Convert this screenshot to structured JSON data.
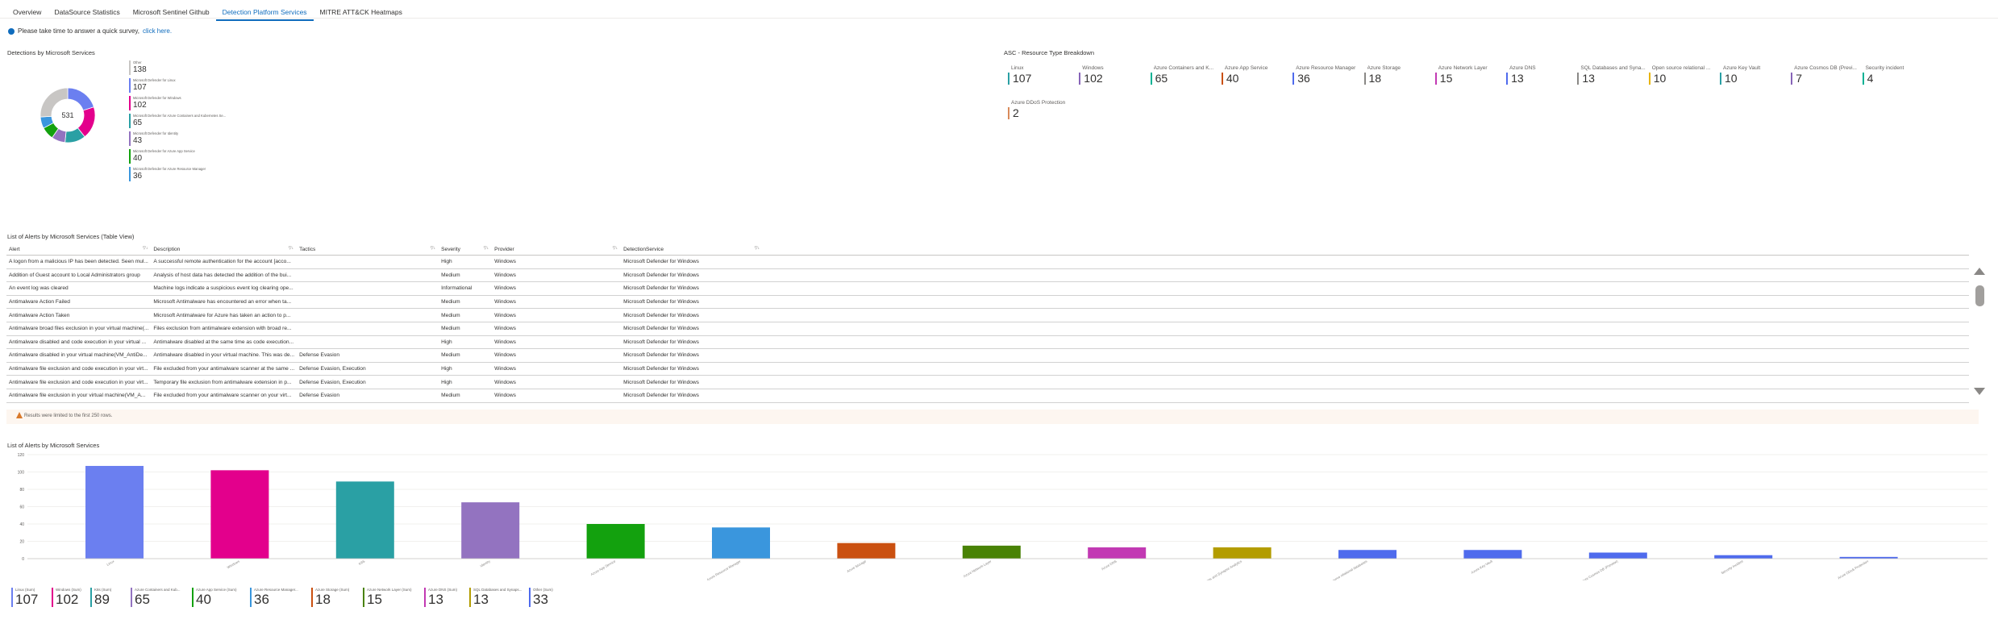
{
  "tabs": [
    "Overview",
    "DataSource Statistics",
    "Microsoft Sentinel Github",
    "Detection Platform Services",
    "MITRE ATT&CK Heatmaps"
  ],
  "active_tab": 3,
  "survey": {
    "text": "Please take time to answer a quick survey,",
    "link": "click here."
  },
  "donut": {
    "title": "Detections by Microsoft Services",
    "total": "531",
    "items": [
      {
        "label": "Other",
        "value": "138",
        "color": "#c8c6c4"
      },
      {
        "label": "Microsoft Defender for Linux",
        "value": "107",
        "color": "#6b7ff0"
      },
      {
        "label": "Microsoft Defender for Windows",
        "value": "102",
        "color": "#e3008c"
      },
      {
        "label": "Microsoft Defender for Azure Containers and Kubernetes Se...",
        "value": "65",
        "color": "#2aa0a4"
      },
      {
        "label": "Microsoft Defender for Identity",
        "value": "43",
        "color": "#9373c0"
      },
      {
        "label": "Microsoft Defender for Azure App Service",
        "value": "40",
        "color": "#13a10e"
      },
      {
        "label": "Microsoft Defender for Azure Resource Manager",
        "value": "36",
        "color": "#3a96dd"
      }
    ]
  },
  "asc": {
    "title": "ASC - Resource Type Breakdown",
    "tiles": [
      {
        "label": "Linux",
        "value": "107",
        "color": "#2aa0a4"
      },
      {
        "label": "Windows",
        "value": "102",
        "color": "#8764b8"
      },
      {
        "label": "Azure Containers and K...",
        "value": "65",
        "color": "#00b294"
      },
      {
        "label": "Azure App Service",
        "value": "40",
        "color": "#ca5010"
      },
      {
        "label": "Azure Resource Manager",
        "value": "36",
        "color": "#4f6bed"
      },
      {
        "label": "Azure Storage",
        "value": "18",
        "color": "#8a8886"
      },
      {
        "label": "Azure Network Layer",
        "value": "15",
        "color": "#c239b3"
      },
      {
        "label": "Azure DNS",
        "value": "13",
        "color": "#4f6bed"
      },
      {
        "label": "SQL Databases and Syna...",
        "value": "13",
        "color": "#8a8886"
      },
      {
        "label": "Open source relational ...",
        "value": "10",
        "color": "#e8b400"
      },
      {
        "label": "Azure Key Vault",
        "value": "10",
        "color": "#2aa0a4"
      },
      {
        "label": "Azure Cosmos DB (Previ...",
        "value": "7",
        "color": "#8764b8"
      },
      {
        "label": "Security incident",
        "value": "4",
        "color": "#00b294"
      },
      {
        "label": "Azure DDoS Protection",
        "value": "2",
        "color": "#d98a5a"
      }
    ]
  },
  "table": {
    "title": "List of Alerts by Microsoft Services (Table View)",
    "columns": [
      "Alert",
      "Description",
      "Tactics",
      "Severity",
      "Provider",
      "DetectionService"
    ],
    "rows": [
      [
        "A logon from a malicious IP has been detected. Seen mul...",
        "A successful remote authentication for the account [acco...",
        "",
        "High",
        "Windows",
        "Microsoft Defender for Windows"
      ],
      [
        "Addition of Guest account to Local Administrators group",
        "Analysis of host data has detected the addition of the bui...",
        "",
        "Medium",
        "Windows",
        "Microsoft Defender for Windows"
      ],
      [
        "An event log was cleared",
        "Machine logs indicate a suspicious event log clearing ope...",
        "",
        "Informational",
        "Windows",
        "Microsoft Defender for Windows"
      ],
      [
        "Antimalware Action Failed",
        "Microsoft Antimalware has encountered an error when ta...",
        "",
        "Medium",
        "Windows",
        "Microsoft Defender for Windows"
      ],
      [
        "Antimalware Action Taken",
        "Microsoft Antimalware for Azure has taken an action to p...",
        "",
        "Medium",
        "Windows",
        "Microsoft Defender for Windows"
      ],
      [
        "Antimalware broad files exclusion in your virtual machine(...",
        "Files exclusion from antimalware extension with broad re...",
        "",
        "Medium",
        "Windows",
        "Microsoft Defender for Windows"
      ],
      [
        "Antimalware disabled and code execution in your virtual ...",
        "Antimalware disabled at the same time as code execution...",
        "",
        "High",
        "Windows",
        "Microsoft Defender for Windows"
      ],
      [
        "Antimalware disabled in your virtual machine(VM_AntiDe...",
        "Antimalware disabled in your virtual machine. This was de...",
        "Defense Evasion",
        "Medium",
        "Windows",
        "Microsoft Defender for Windows"
      ],
      [
        "Antimalware file exclusion and code execution in your virt...",
        "File excluded from your antimalware scanner at the same ...",
        "Defense Evasion, Execution",
        "High",
        "Windows",
        "Microsoft Defender for Windows"
      ],
      [
        "Antimalware file exclusion and code execution in your virt...",
        "Temporary file exclusion from antimalware extension in p...",
        "Defense Evasion, Execution",
        "High",
        "Windows",
        "Microsoft Defender for Windows"
      ],
      [
        "Antimalware file exclusion in your virtual machine(VM_A...",
        "File excluded from your antimalware scanner on your virt...",
        "Defense Evasion",
        "Medium",
        "Windows",
        "Microsoft Defender for Windows"
      ]
    ],
    "warning": "Results were limited to the first 250 rows."
  },
  "chart_data": {
    "type": "bar",
    "title": "List of Alerts by Microsoft Services",
    "categories": [
      "Linux",
      "Windows",
      "K8S",
      "Identity",
      "Azure App Service",
      "Azure Resource Manager",
      "Azure Storage",
      "Azure Network Layer",
      "Azure DNS",
      "SQL Databases and Synapse Analytics",
      "Open-source relational databases",
      "Azure Key Vault",
      "Azure Cosmos DB (Preview)",
      "Security incident",
      "Azure DDoS Protection"
    ],
    "values": [
      107,
      102,
      89,
      65,
      40,
      36,
      18,
      15,
      13,
      13,
      10,
      10,
      7,
      4,
      2
    ],
    "colors": [
      "#6b7ff0",
      "#e3008c",
      "#2aa0a4",
      "#9373c0",
      "#13a10e",
      "#3a96dd",
      "#ca5010",
      "#498205",
      "#c239b3",
      "#b39c00",
      "#4f6bed",
      "#4f6bed",
      "#4f6bed",
      "#4f6bed",
      "#4f6bed"
    ],
    "yticks": [
      "0",
      "20",
      "40",
      "60",
      "80",
      "100",
      "120"
    ],
    "ylim": [
      0,
      120
    ],
    "grid": true
  },
  "bar_legend": [
    {
      "label": "Linux (Sum)",
      "value": "107",
      "color": "#6b7ff0"
    },
    {
      "label": "Windows (Sum)",
      "value": "102",
      "color": "#e3008c"
    },
    {
      "label": "K8s (Sum)",
      "value": "89",
      "color": "#2aa0a4"
    },
    {
      "label": "Azure Containers and Kub...",
      "value": "65",
      "color": "#9373c0"
    },
    {
      "label": "Azure App Service (Sum)",
      "value": "40",
      "color": "#13a10e"
    },
    {
      "label": "Azure Resource Manager...",
      "value": "36",
      "color": "#3a96dd"
    },
    {
      "label": "Azure Storage (Sum)",
      "value": "18",
      "color": "#ca5010"
    },
    {
      "label": "Azure Network Layer (Sum)",
      "value": "15",
      "color": "#498205"
    },
    {
      "label": "Azure DNS (Sum)",
      "value": "13",
      "color": "#c239b3"
    },
    {
      "label": "SQL Databases and Synaps...",
      "value": "13",
      "color": "#b39c00"
    },
    {
      "label": "Other (Sum)",
      "value": "33",
      "color": "#4f6bed"
    }
  ]
}
